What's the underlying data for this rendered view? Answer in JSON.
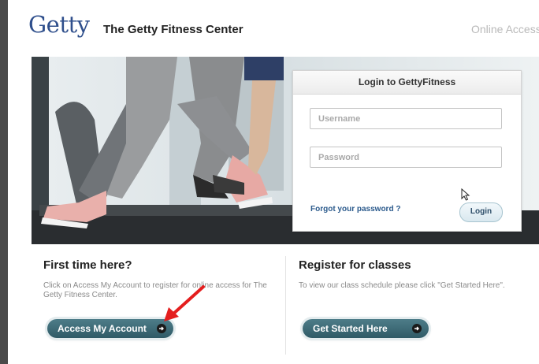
{
  "header": {
    "logo_text": "Getty",
    "site_title": "The Getty Fitness Center",
    "online_access": "Online Access"
  },
  "login": {
    "title": "Login to GettyFitness",
    "username_placeholder": "Username",
    "password_placeholder": "Password",
    "forgot_label": "Forgot your password ?",
    "login_label": "Login"
  },
  "first_time": {
    "heading": "First time here?",
    "text": "Click on Access My Account to register for online access for The Getty Fitness Center.",
    "button_label": "Access My Account"
  },
  "register": {
    "heading": "Register for classes",
    "text": "To view our class schedule please click \"Get Started Here\".",
    "button_label": "Get Started Here"
  },
  "colors": {
    "logo": "#2f4f8c",
    "button": "#3f6c78",
    "annotation_arrow": "#e41e1e",
    "link": "#2b5a8c"
  },
  "icons": {
    "button_arrow": "arrow-right-icon",
    "annotation": "red-arrow-icon",
    "pointer": "mouse-cursor-icon"
  }
}
